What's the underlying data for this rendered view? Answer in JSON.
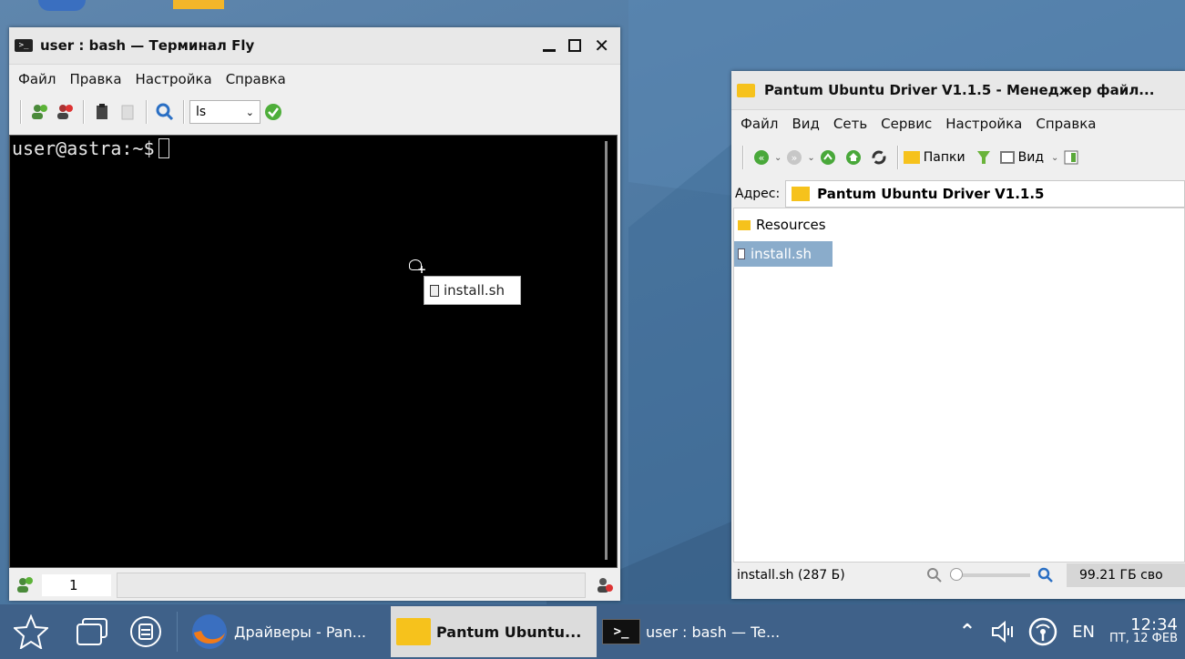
{
  "terminal": {
    "title": "user : bash — Терминал Fly",
    "menu": [
      "Файл",
      "Правка",
      "Настройка",
      "Справка"
    ],
    "command_select": "ls",
    "prompt": "user@astra:~$",
    "tab_number": "1"
  },
  "drag": {
    "filename": "install.sh"
  },
  "filemanager": {
    "title": "Pantum Ubuntu Driver V1.1.5 - Менеджер файл...",
    "menu": [
      "Файл",
      "Вид",
      "Сеть",
      "Сервис",
      "Настройка",
      "Справка"
    ],
    "toolbar": {
      "folders_label": "Папки",
      "view_label": "Вид"
    },
    "address_label": "Адрес:",
    "address_value": "Pantum Ubuntu Driver V1.1.5",
    "files": [
      {
        "name": "Resources",
        "type": "folder"
      },
      {
        "name": "install.sh",
        "type": "script"
      }
    ],
    "status_text": "install.sh (287 Б)",
    "free_space": "99.21 ГБ сво"
  },
  "taskbar": {
    "tasks": [
      {
        "label": "Драйверы - Pan...",
        "icon": "firefox-icon"
      },
      {
        "label": "Pantum Ubuntu...",
        "icon": "folder-icon"
      },
      {
        "label": "user : bash — Te...",
        "icon": "terminal-icon"
      }
    ],
    "lang": "EN",
    "time": "12:34",
    "date": "ПТ, 12 ФЕВ"
  },
  "colors": {
    "desktop": "#4f7aa3",
    "taskbar": "#3f6189",
    "selection": "#8aaccb",
    "folder": "#f6c21c"
  }
}
